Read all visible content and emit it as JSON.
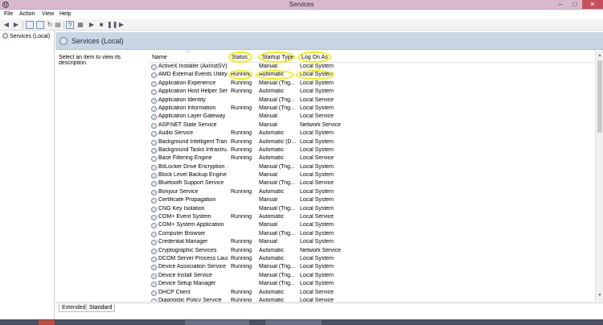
{
  "window": {
    "title": "Services"
  },
  "menu": [
    "File",
    "Action",
    "View",
    "Help"
  ],
  "tree": {
    "node": "Services (Local)"
  },
  "panel": {
    "title": "Services (Local)",
    "description": "Select an item to view its description."
  },
  "columns": {
    "name": "Name",
    "status": "Status",
    "startup": "Startup Type",
    "logon": "Log On As"
  },
  "rows": [
    {
      "name": "ActiveX Installer (AxInstSV)",
      "status": "",
      "startup": "Manual",
      "logon": "Local System"
    },
    {
      "name": "AMD External Events Utility",
      "status": "Running",
      "startup": "Automatic",
      "logon": "Local System"
    },
    {
      "name": "Application Experience",
      "status": "Running",
      "startup": "Manual (Trig...",
      "logon": "Local System"
    },
    {
      "name": "Application Host Helper Ser...",
      "status": "Running",
      "startup": "Automatic",
      "logon": "Local System"
    },
    {
      "name": "Application Identity",
      "status": "",
      "startup": "Manual (Trig...",
      "logon": "Local Service"
    },
    {
      "name": "Application Information",
      "status": "Running",
      "startup": "Manual (Trig...",
      "logon": "Local System"
    },
    {
      "name": "Application Layer Gateway ...",
      "status": "",
      "startup": "Manual",
      "logon": "Local Service"
    },
    {
      "name": "ASP.NET State Service",
      "status": "",
      "startup": "Manual",
      "logon": "Network Service"
    },
    {
      "name": "Audio Service",
      "status": "Running",
      "startup": "Automatic",
      "logon": "Local System"
    },
    {
      "name": "Background Intelligent Tran...",
      "status": "Running",
      "startup": "Automatic (D...",
      "logon": "Local System"
    },
    {
      "name": "Background Tasks Infrastru...",
      "status": "Running",
      "startup": "Automatic",
      "logon": "Local System"
    },
    {
      "name": "Base Filtering Engine",
      "status": "Running",
      "startup": "Automatic",
      "logon": "Local Service"
    },
    {
      "name": "BitLocker Drive Encryption ...",
      "status": "",
      "startup": "Manual (Trig...",
      "logon": "Local System"
    },
    {
      "name": "Block Level Backup Engine ...",
      "status": "",
      "startup": "Manual",
      "logon": "Local System"
    },
    {
      "name": "Bluetooth Support Service",
      "status": "",
      "startup": "Manual (Trig...",
      "logon": "Local Service"
    },
    {
      "name": "Bonjour Service",
      "status": "Running",
      "startup": "Automatic",
      "logon": "Local System"
    },
    {
      "name": "Certificate Propagation",
      "status": "",
      "startup": "Manual",
      "logon": "Local System"
    },
    {
      "name": "CNG Key Isolation",
      "status": "",
      "startup": "Manual (Trig...",
      "logon": "Local System"
    },
    {
      "name": "COM+ Event System",
      "status": "Running",
      "startup": "Automatic",
      "logon": "Local Service"
    },
    {
      "name": "COM+ System Application",
      "status": "",
      "startup": "Manual",
      "logon": "Local System"
    },
    {
      "name": "Computer Browser",
      "status": "",
      "startup": "Manual (Trig...",
      "logon": "Local System"
    },
    {
      "name": "Credential Manager",
      "status": "Running",
      "startup": "Manual",
      "logon": "Local System"
    },
    {
      "name": "Cryptographic Services",
      "status": "Running",
      "startup": "Automatic",
      "logon": "Network Service"
    },
    {
      "name": "DCOM Server Process Laun...",
      "status": "Running",
      "startup": "Automatic",
      "logon": "Local System"
    },
    {
      "name": "Device Association Service",
      "status": "Running",
      "startup": "Manual (Trig...",
      "logon": "Local System"
    },
    {
      "name": "Device Install Service",
      "status": "",
      "startup": "Manual (Trig...",
      "logon": "Local System"
    },
    {
      "name": "Device Setup Manager",
      "status": "",
      "startup": "Manual (Trig...",
      "logon": "Local System"
    },
    {
      "name": "DHCP Client",
      "status": "Running",
      "startup": "Automatic",
      "logon": "Local Service"
    },
    {
      "name": "Diagnostic Policy Service",
      "status": "Running",
      "startup": "Automatic",
      "logon": "Local Service"
    }
  ],
  "tabs": [
    "Extended",
    "Standard"
  ]
}
